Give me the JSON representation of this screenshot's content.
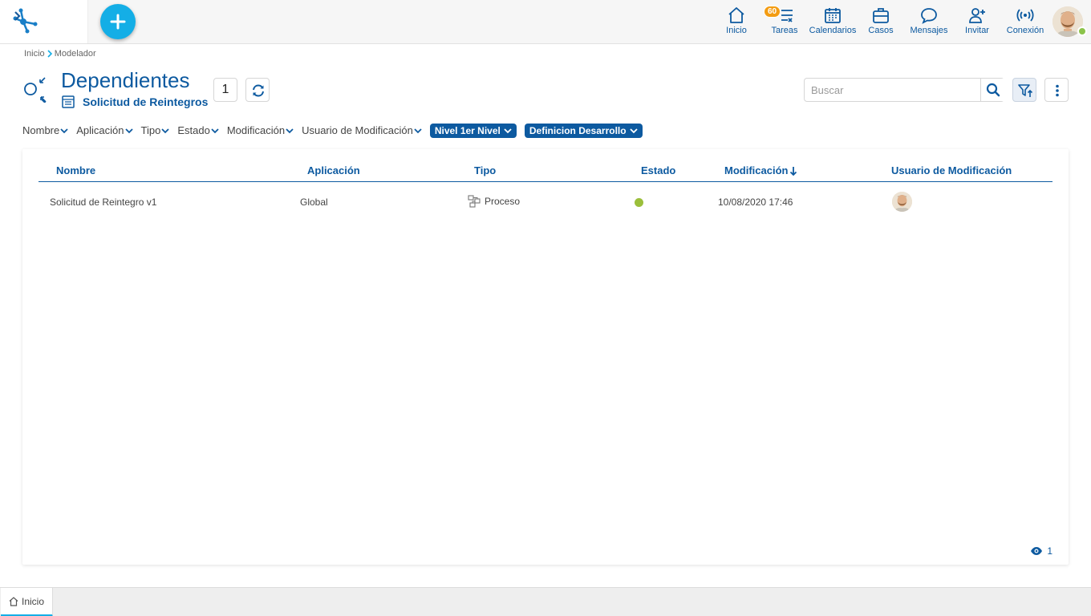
{
  "topnav": {
    "items": [
      {
        "label": "Inicio",
        "icon": "home-icon"
      },
      {
        "label": "Tareas",
        "icon": "tasks-icon",
        "badge": "60"
      },
      {
        "label": "Calendarios",
        "icon": "calendar-icon"
      },
      {
        "label": "Casos",
        "icon": "briefcase-icon"
      },
      {
        "label": "Mensajes",
        "icon": "message-icon"
      },
      {
        "label": "Invitar",
        "icon": "invite-icon"
      },
      {
        "label": "Conexion",
        "icon": "connection-icon"
      }
    ],
    "labels": {
      "inicio": "Inicio",
      "tareas": "Tareas",
      "tareas_badge": "60",
      "calendarios": "Calendarios",
      "casos": "Casos",
      "mensajes": "Mensajes",
      "invitar": "Invitar",
      "conexion": "Conexión"
    }
  },
  "breadcrumb": {
    "home": "Inicio",
    "current": "Modelador"
  },
  "header": {
    "title": "Dependientes",
    "subtitle": "Solicitud de Reintegros",
    "count": "1"
  },
  "search": {
    "placeholder": "Buscar"
  },
  "filters": {
    "nombre": "Nombre",
    "aplicacion": "Aplicación",
    "tipo": "Tipo",
    "estado": "Estado",
    "modificacion": "Modificación",
    "usuario": "Usuario de Modificación",
    "chip_nivel": "Nivel 1er Nivel",
    "chip_definicion": "Definicion Desarrollo"
  },
  "table": {
    "columns": {
      "nombre": "Nombre",
      "aplicacion": "Aplicación",
      "tipo": "Tipo",
      "estado": "Estado",
      "modificacion": "Modificación",
      "usuario": "Usuario de Modificación"
    },
    "rows": [
      {
        "nombre": "Solicitud de Reintegro v1",
        "aplicacion": "Global",
        "tipo": "Proceso",
        "estado_color": "#9bbf3b",
        "modificacion": "10/08/2020 17:46"
      }
    ],
    "footer_count": "1"
  },
  "bottom_tabs": {
    "inicio": "Inicio"
  },
  "colors": {
    "primary": "#0d5aa0",
    "accent": "#14aee6",
    "online": "#8bc34a",
    "badge": "#f39c12"
  }
}
